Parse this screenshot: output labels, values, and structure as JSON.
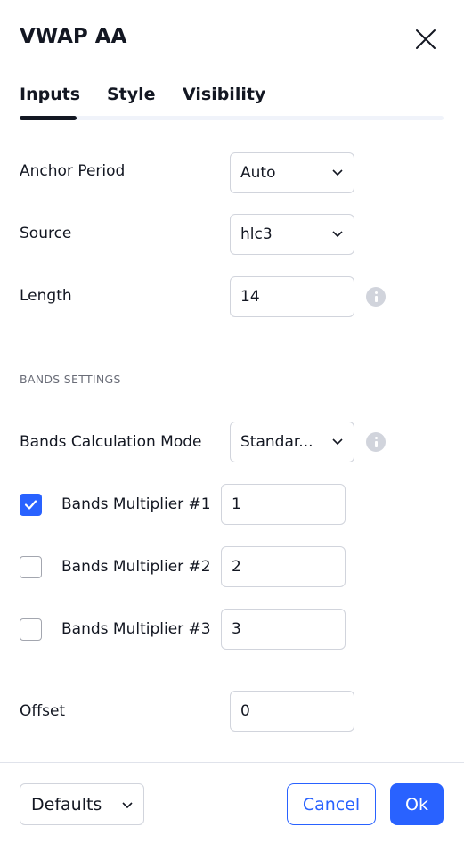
{
  "dialog": {
    "title": "VWAP AA",
    "close_icon": "close-icon"
  },
  "tabs": [
    {
      "label": "Inputs",
      "active": true
    },
    {
      "label": "Style",
      "active": false
    },
    {
      "label": "Visibility",
      "active": false
    }
  ],
  "inputs": {
    "anchor_period": {
      "label": "Anchor Period",
      "value": "Auto"
    },
    "source": {
      "label": "Source",
      "value": "hlc3"
    },
    "length": {
      "label": "Length",
      "value": "14"
    },
    "bands_section": "BANDS SETTINGS",
    "bands_mode": {
      "label": "Bands Calculation Mode",
      "value": "Standar..."
    },
    "multipliers": [
      {
        "label": "Bands Multiplier #1",
        "value": "1",
        "checked": true
      },
      {
        "label": "Bands Multiplier #2",
        "value": "2",
        "checked": false
      },
      {
        "label": "Bands Multiplier #3",
        "value": "3",
        "checked": false
      }
    ],
    "offset": {
      "label": "Offset",
      "value": "0"
    }
  },
  "footer": {
    "defaults_label": "Defaults",
    "cancel_label": "Cancel",
    "ok_label": "Ok"
  },
  "colors": {
    "accent": "#2962ff",
    "text": "#131722",
    "border": "#d1d4dc"
  }
}
